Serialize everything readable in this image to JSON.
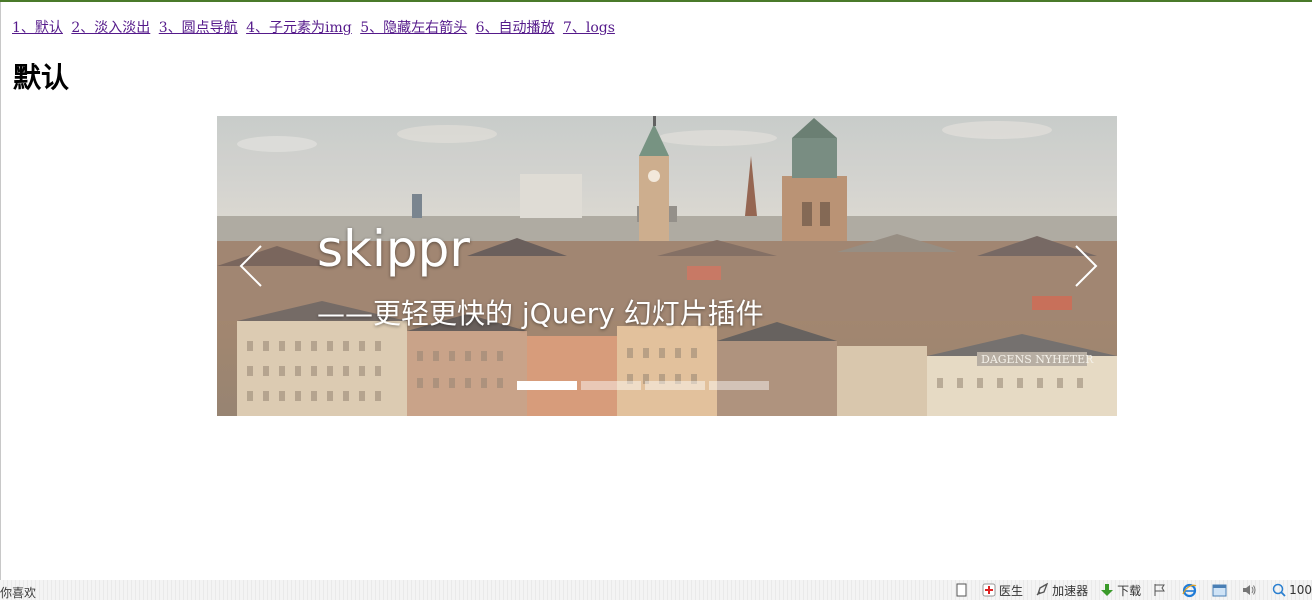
{
  "nav": {
    "links": [
      "1、默认",
      "2、淡入淡出",
      "3、圆点导航",
      "4、子元素为img",
      "5、隐藏左右箭头",
      "6、自动播放",
      "7、logs"
    ]
  },
  "page": {
    "title": "默认"
  },
  "slider": {
    "title": "skippr",
    "subtitle": "——更轻更快的 jQuery 幻灯片插件",
    "slide_count": 4,
    "active_index": 0
  },
  "statusbar": {
    "left_text": "你喜欢",
    "items": [
      {
        "icon": "page-icon",
        "label": ""
      },
      {
        "icon": "doctor-icon",
        "label": "医生"
      },
      {
        "icon": "rocket-icon",
        "label": "加速器"
      },
      {
        "icon": "download-icon",
        "label": "下载"
      },
      {
        "icon": "flag-icon",
        "label": ""
      },
      {
        "icon": "ie-icon",
        "label": ""
      },
      {
        "icon": "window-icon",
        "label": ""
      },
      {
        "icon": "speaker-icon",
        "label": ""
      },
      {
        "icon": "zoom-icon",
        "label": "100"
      }
    ]
  },
  "colors": {
    "link": "#551a8b",
    "top_border": "#4a7a2a",
    "dot_active": "#ffffff"
  }
}
